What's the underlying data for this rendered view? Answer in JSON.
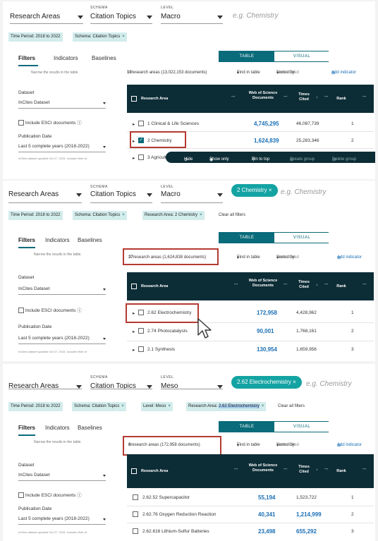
{
  "panel1": {
    "selectors": {
      "research_areas": "Research Areas",
      "schema_label": "SCHEMA",
      "schema_value": "Citation Topics",
      "level_label": "LEVEL",
      "level_value": "Macro",
      "placeholder": "e.g. Chemistry"
    },
    "chips": {
      "time_key": "Time Period:",
      "time_val": "2018 to 2022",
      "schema": "Schema: Citation Topics",
      "x": "×"
    },
    "tabs": [
      "Filters",
      "Indicators",
      "Baselines"
    ],
    "sidebar": {
      "narrow": "Narrow the results in the table.",
      "dataset_label": "Dataset",
      "dataset_value": "InCites Dataset",
      "esci": "Include ESCI documents",
      "info": "ⓘ",
      "pubdate_label": "Publication Date",
      "pubdate_value": "Last 5 complete years (2018-2022)",
      "updated": "InCites dataset updated Oct 27, 2023. Includes Web of"
    },
    "toggle": {
      "table": "TABLE",
      "visual": "VISUAL"
    },
    "toolbar": {
      "count": "10",
      "count_rest": "research areas (13,022,153 documents)",
      "find": "Find in table",
      "sorted": "Sorted by",
      "sorted_val": "Times Cited",
      "add": "Add indicator"
    },
    "header": {
      "area": "Research Area",
      "wos": "Web of Science Documents",
      "tc": "Times Cited",
      "rank": "Rank"
    },
    "rows": [
      {
        "name": "1 Clinical & Life Sciences",
        "wos": "4,745,295",
        "tc": "46,087,739",
        "rank": "1"
      },
      {
        "name": "2 Chemistry",
        "wos": "1,624,839",
        "tc": "25,283,346",
        "rank": "2"
      },
      {
        "name": "3 Agricult",
        "wos": "",
        "tc": "",
        "rank": ""
      }
    ],
    "actionbar": {
      "hide": "Hide",
      "show_only": "Show only",
      "pin": "Pin to top",
      "create": "Create group",
      "delete": "Delete group"
    }
  },
  "panel2": {
    "selectors": {
      "research_areas": "Research Areas",
      "schema_label": "SCHEMA",
      "schema_value": "Citation Topics",
      "level_label": "LEVEL",
      "level_value": "Macro",
      "active_chip": "2 Chemistry",
      "placeholder": "e.g. Chemistry"
    },
    "chips": {
      "time_key": "Time Period:",
      "time_val": "2018 to 2022",
      "schema": "Schema: Citation Topics",
      "area": "Research Area: 2 Chemistry",
      "clear": "Clear all filters",
      "x": "×"
    },
    "tabs": [
      "Filters",
      "Indicators",
      "Baselines"
    ],
    "sidebar": {
      "narrow": "Narrow the results in the table.",
      "dataset_label": "Dataset",
      "dataset_value": "InCites Dataset",
      "esci": "Include ESCI documents",
      "info": "ⓘ",
      "pubdate_label": "Publication Date",
      "pubdate_value": "Last 5 complete years (2018-2022)",
      "updated": "InCites dataset updated Oct 27, 2023. Includes Web of"
    },
    "toggle": {
      "table": "TABLE",
      "visual": "VISUAL"
    },
    "toolbar": {
      "count": "37",
      "count_rest": "research areas (1,624,838 documents)",
      "find": "Find in table",
      "sorted": "Sorted by",
      "sorted_val": "Times Cited",
      "add": "Add indicator"
    },
    "header": {
      "area": "Research Area",
      "wos": "Web of Science Documents",
      "tc": "Times Cited",
      "rank": "Rank"
    },
    "rows": [
      {
        "name": "2.62 Electrochemistry",
        "wos": "172,958",
        "tc": "4,428,962",
        "rank": "1"
      },
      {
        "name": "2.74 Photocatalysts",
        "wos": "90,001",
        "tc": "1,768,161",
        "rank": "2"
      },
      {
        "name": "2.1 Synthesis",
        "wos": "130,954",
        "tc": "1,659,956",
        "rank": "3"
      }
    ]
  },
  "panel3": {
    "selectors": {
      "research_areas": "Research Areas",
      "schema_label": "SCHEMA",
      "schema_value": "Citation Topics",
      "level_label": "LEVEL",
      "level_value": "Meso",
      "active_chip": "2.62 Electrochemistry",
      "placeholder": "e.g. Chemistry"
    },
    "chips": {
      "time_key": "Time Period:",
      "time_val": "2018 to 2022",
      "schema": "Schema: Citation Topics",
      "level": "Level: Meso",
      "area_key": "Research Area:",
      "area_val": "2.62 Electrochemistry",
      "clear": "Clear all filters",
      "x": "×"
    },
    "tabs": [
      "Filters",
      "Indicators",
      "Baselines"
    ],
    "sidebar": {
      "narrow": "Narrow the results in the table.",
      "dataset_label": "Dataset",
      "dataset_value": "InCites Dataset",
      "esci": "Include ESCI documents",
      "info": "ⓘ",
      "pubdate_label": "Publication Date",
      "pubdate_value": "Last 5 complete years (2018-2022)",
      "updated": "InCites dataset updated Oct 27, 2023. Includes Web of"
    },
    "toggle": {
      "table": "TABLE",
      "visual": "VISUAL"
    },
    "toolbar": {
      "count": "8",
      "count_rest": "research areas (172,958 documents)",
      "find": "Find in table",
      "sorted": "Sorted by",
      "sorted_val": "Times Cited",
      "add": "Add indicator"
    },
    "header": {
      "area": "Research Area",
      "wos": "Web of Science Documents",
      "tc": "Times Cited",
      "rank": "Rank"
    },
    "rows": [
      {
        "name": "2.62.52 Supercapacitor",
        "wos": "55,194",
        "tc": "1,523,722",
        "rank": "1"
      },
      {
        "name": "2.62.76 Oxygen Reduction Reaction",
        "wos": "40,341",
        "tc": "1,214,999",
        "rank": "2"
      },
      {
        "name": "2.62.616 Lithium-Sulfur Batteries",
        "wos": "23,498",
        "tc": "655,292",
        "rank": "3"
      }
    ]
  }
}
